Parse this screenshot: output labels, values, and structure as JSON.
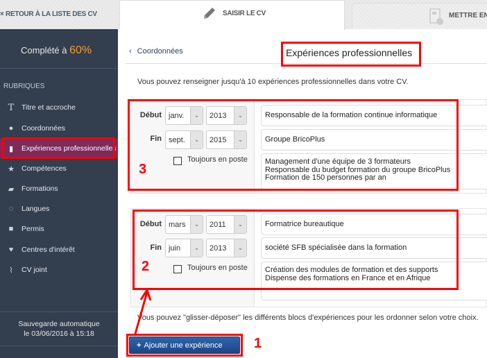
{
  "header": {
    "back_label": "RETOUR À LA LISTE DES CV",
    "tabs": [
      {
        "label": "SAISIR LE CV",
        "icon": "pencil-icon",
        "active": true
      },
      {
        "label": "METTRE EN",
        "icon": "document-layout-icon",
        "active": false
      }
    ]
  },
  "sidebar": {
    "completion_label": "Complété à",
    "completion_value": "60%",
    "section_title": "RUBRIQUES",
    "items": [
      {
        "label": "Titre et accroche",
        "icon": "title-icon"
      },
      {
        "label": "Coordonnées",
        "icon": "user-icon"
      },
      {
        "label": "Expériences professionnelles",
        "icon": "briefcase-icon",
        "active": true
      },
      {
        "label": "Compétences",
        "icon": "star-icon"
      },
      {
        "label": "Formations",
        "icon": "book-icon"
      },
      {
        "label": "Langues",
        "icon": "chat-icon"
      },
      {
        "label": "Permis",
        "icon": "truck-icon"
      },
      {
        "label": "Centres d'intérêt",
        "icon": "heart-icon"
      },
      {
        "label": "CV joint",
        "icon": "paperclip-icon"
      }
    ],
    "autosave_line1": "Sauvegarde automatique",
    "autosave_line2": "le 03/06/2016 à 15:18"
  },
  "main": {
    "breadcrumb": "Coordonnées",
    "title": "Expériences professionnelles",
    "intro": "Vous pouvez renseigner jusqu'à 10 expériences professionnelles dans votre CV.",
    "start_label": "Début",
    "end_label": "Fin",
    "current_label": "Toujours en poste",
    "experiences": [
      {
        "start_month": "janv.",
        "start_year": "2013",
        "end_month": "sept.",
        "end_year": "2015",
        "current": false,
        "job_title": "Responsable de la formation continue informatique",
        "company": "Groupe BricoPlus",
        "description_lines": [
          "Management d'une équipe de 3 formateurs",
          "Responsable du budget formation du groupe BricoPlus",
          "Formation de 150 personnes par an"
        ]
      },
      {
        "start_month": "mars",
        "start_year": "2011",
        "end_month": "juin",
        "end_year": "2013",
        "current": false,
        "job_title": "Formatrice bureautique",
        "company": "société SFB spécialisée dans la formation",
        "description_lines": [
          "Création des modules de formation et des supports",
          "Dispense des formations en France et en Afrique"
        ]
      }
    ],
    "drag_hint": "Vous pouvez \"glisser-déposer\" les différents blocs d'expériences pour les ordonner selon votre choix.",
    "add_button": "Ajouter une expérience"
  },
  "annotations": {
    "numbers": [
      "1",
      "2",
      "3"
    ],
    "color": "#ff0000"
  },
  "colors": {
    "sidebar": "#333e4f",
    "active_item": "#7e2a5b",
    "accent": "#f39c34",
    "button": "#1c4587"
  }
}
